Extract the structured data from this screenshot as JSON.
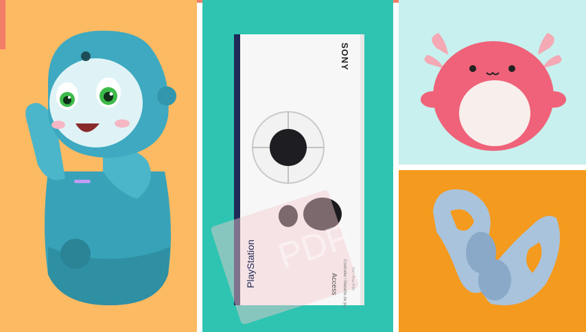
{
  "colors": {
    "panel_robot_bg": "#fcba63",
    "panel_controller_bg": "#2ec4b1",
    "panel_plush_bg": "#c8f0ee",
    "panel_earplug_bg": "#f49a1e",
    "accent_strip": "#f27d69"
  },
  "controller_box": {
    "brand": "SONY",
    "product_line": "PlayStation",
    "model": "Access",
    "subtitle": "Controller / Manette de jeu",
    "platform_note": "For / Pour PS5"
  },
  "watermark": {
    "text": "PDF"
  },
  "images": [
    {
      "name": "robot-toy",
      "description_icon": "robot-icon"
    },
    {
      "name": "access-controller-box",
      "description_icon": "controller-icon"
    },
    {
      "name": "axolotl-plush",
      "description_icon": "plush-icon"
    },
    {
      "name": "earplugs",
      "description_icon": "earplug-icon"
    }
  ]
}
